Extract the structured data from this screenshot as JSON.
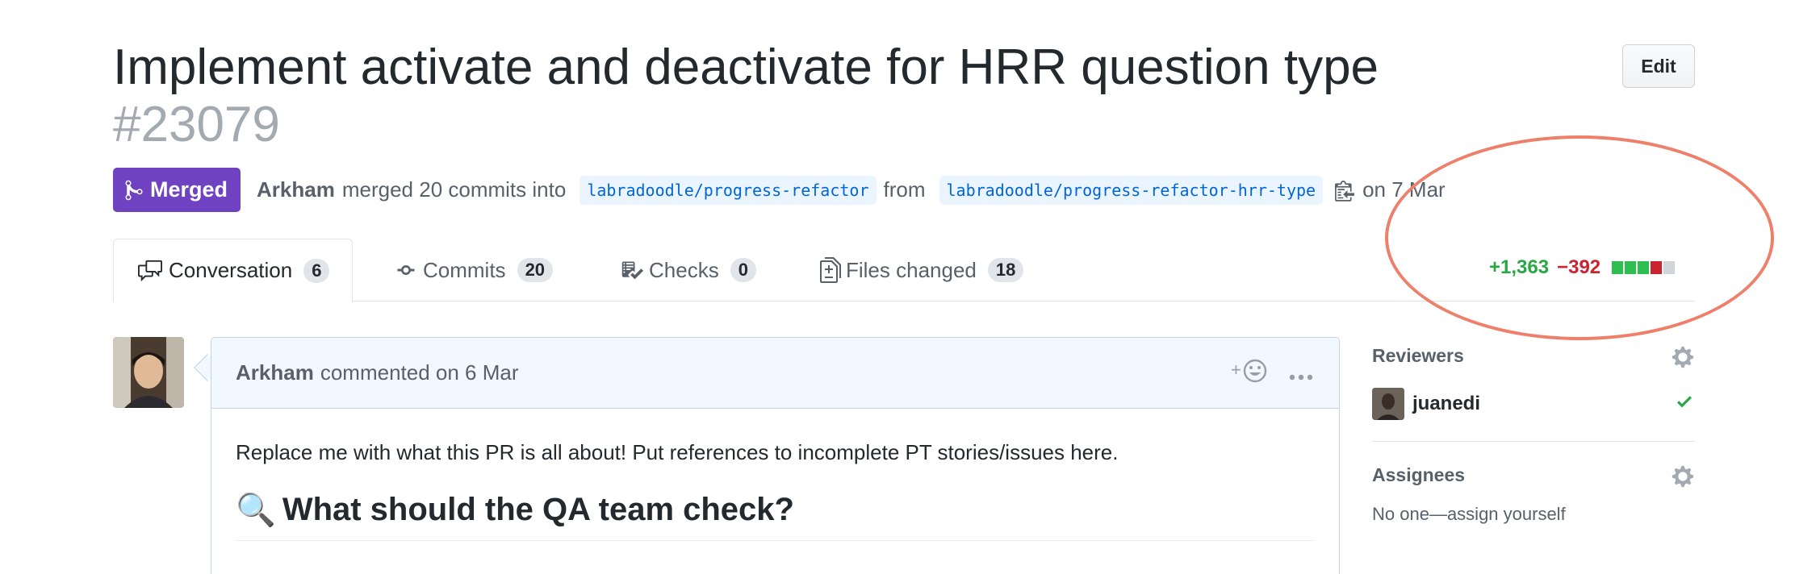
{
  "header": {
    "title": "Implement activate and deactivate for HRR question type",
    "number": "#23079",
    "edit_label": "Edit"
  },
  "meta": {
    "state_label": "Merged",
    "author": "Arkham",
    "merge_text": "merged 20 commits into",
    "base_branch": "labradoodle/progress-refactor",
    "from_text": "from",
    "head_branch": "labradoodle/progress-refactor-hrr-type",
    "date_text": "on 7 Mar"
  },
  "tabs": [
    {
      "label": "Conversation",
      "count": "6",
      "icon": "comment-discussion-icon"
    },
    {
      "label": "Commits",
      "count": "20",
      "icon": "git-commit-icon"
    },
    {
      "label": "Checks",
      "count": "0",
      "icon": "checklist-icon"
    },
    {
      "label": "Files changed",
      "count": "18",
      "icon": "file-diff-icon"
    }
  ],
  "diffstat": {
    "additions": "+1,363",
    "deletions": "−392",
    "blocks": [
      "#2cbe4e",
      "#2cbe4e",
      "#2cbe4e",
      "#cb2431",
      "#d1d5da"
    ]
  },
  "comment": {
    "author": "Arkham",
    "action_text": "commented on 6 Mar",
    "body_text": "Replace me with what this PR is all about! Put references to incomplete PT stories/issues here.",
    "heading_emoji": "🔍",
    "heading": "What should the QA team check?"
  },
  "sidebar": {
    "reviewers_heading": "Reviewers",
    "reviewer_name": "juanedi",
    "assignees_heading": "Assignees",
    "assignees_empty": "No one—assign yourself"
  },
  "colors": {
    "merged": "#6f42c1",
    "annotation": "#ee806b",
    "link": "#0366d6"
  }
}
